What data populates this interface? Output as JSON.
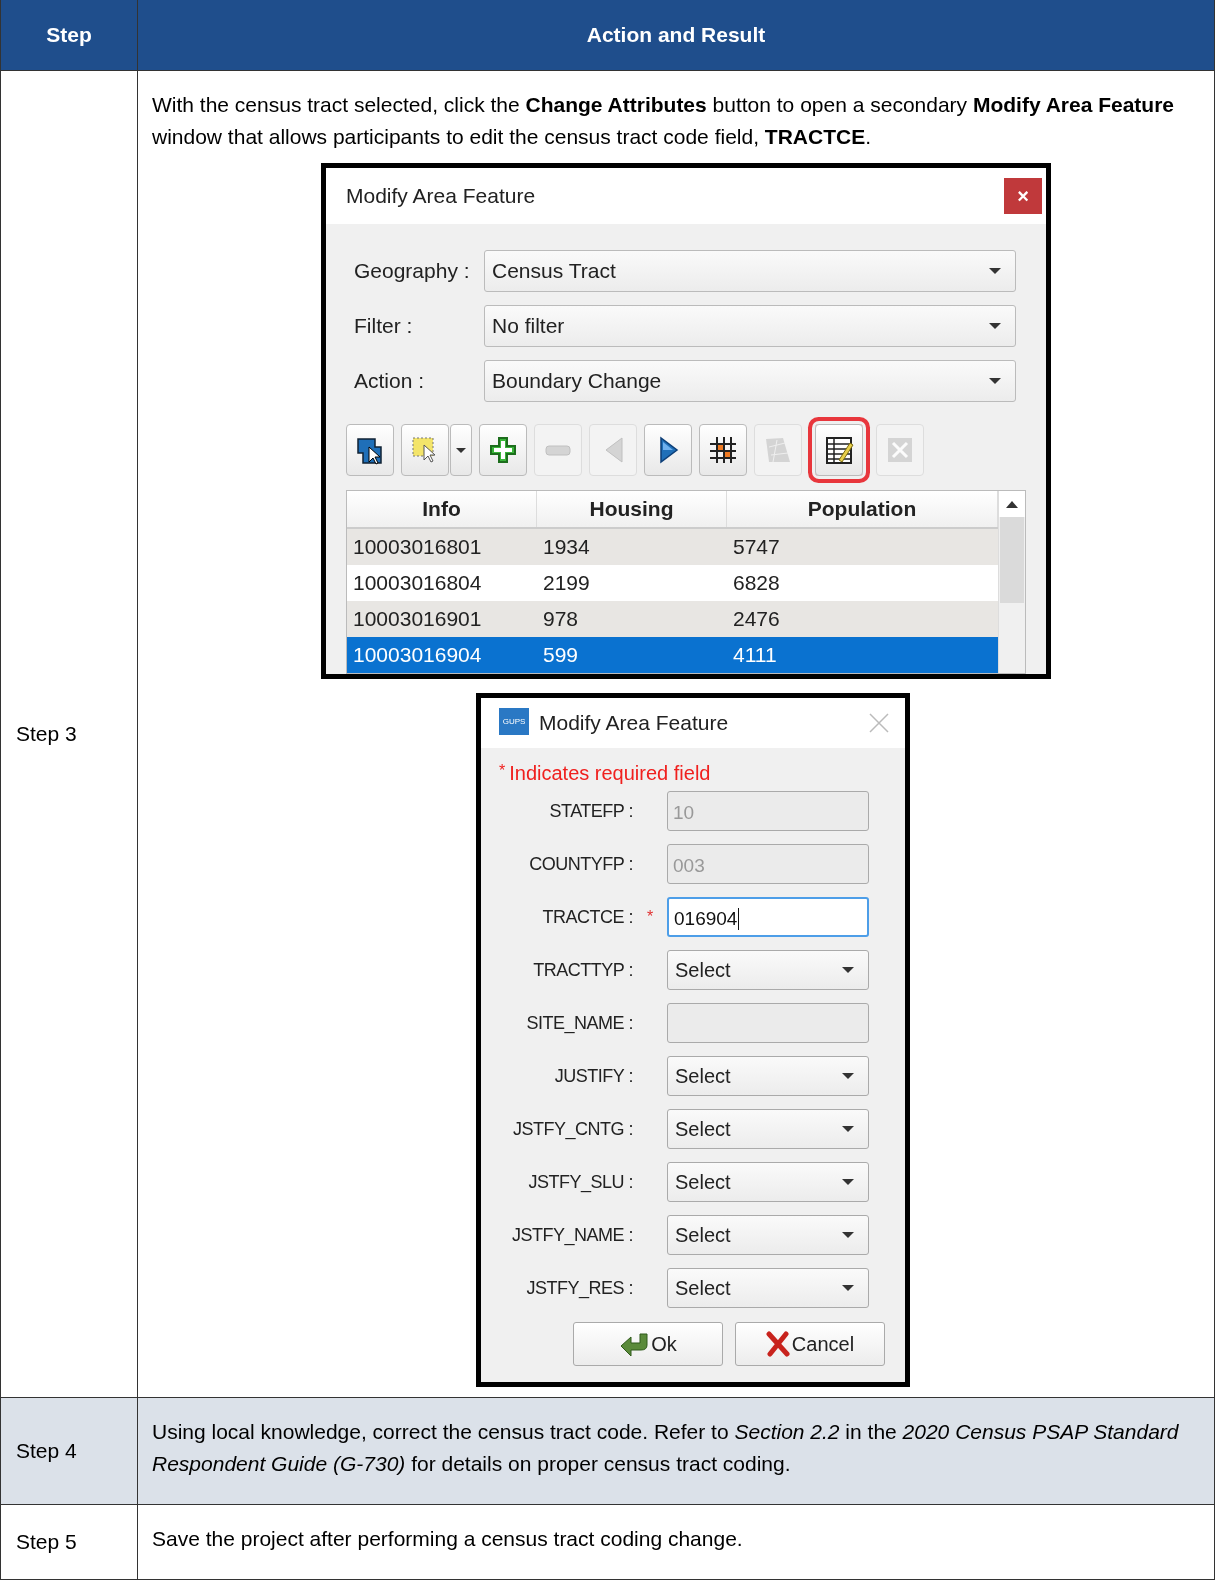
{
  "table": {
    "columns": [
      "Step",
      "Action and Result"
    ],
    "rows": [
      {
        "step": "Step 3",
        "shaded": false,
        "text": "With the census tract selected, click the **Change Attributes** button to open a secondary **Modify Area Feature** window that allows participants to edit the census tract code field, **TRACTCE**.",
        "main_dialog": {
          "title": "Modify Area Feature",
          "close": "×",
          "fields": [
            {
              "label": "Geography :",
              "value": "Census Tract"
            },
            {
              "label": "Filter :",
              "value": "No filter"
            },
            {
              "label": "Action :",
              "value": "Boundary Change"
            }
          ],
          "toolbar": [
            {
              "kind": "select-feature",
              "disabled": false,
              "highlighted": false
            },
            {
              "kind": "select-area",
              "disabled": false,
              "highlighted": false
            },
            {
              "kind": "add",
              "disabled": false,
              "highlighted": false
            },
            {
              "kind": "remove",
              "disabled": true,
              "highlighted": false
            },
            {
              "kind": "previous",
              "disabled": true,
              "highlighted": false
            },
            {
              "kind": "next",
              "disabled": false,
              "highlighted": false
            },
            {
              "kind": "grid",
              "disabled": false,
              "highlighted": false
            },
            {
              "kind": "map",
              "disabled": true,
              "highlighted": false
            },
            {
              "kind": "edit-table",
              "disabled": false,
              "highlighted": true
            },
            {
              "kind": "delete",
              "disabled": true,
              "highlighted": false
            }
          ],
          "grid": {
            "columns": [
              "Info",
              "Housing",
              "Population"
            ],
            "rows": [
              {
                "cells": [
                  "10003016801",
                  "1934",
                  "5747"
                ],
                "selected": false
              },
              {
                "cells": [
                  "10003016804",
                  "2199",
                  "6828"
                ],
                "selected": false
              },
              {
                "cells": [
                  "10003016901",
                  "978",
                  "2476"
                ],
                "selected": false
              },
              {
                "cells": [
                  "10003016904",
                  "599",
                  "4111"
                ],
                "selected": true
              }
            ]
          }
        },
        "attr_dialog": {
          "logo_text": "GUPS",
          "title": "Modify Area Feature",
          "note_mark": "*",
          "note": "Indicates required field",
          "required_mark": "*",
          "fields": [
            {
              "label": "STATEFP :",
              "kind": "text",
              "value": "10",
              "required": false,
              "disabled": true,
              "focused": false
            },
            {
              "label": "COUNTYFP :",
              "kind": "text",
              "value": "003",
              "required": false,
              "disabled": true,
              "focused": false
            },
            {
              "label": "TRACTCE :",
              "kind": "text",
              "value": "016904",
              "required": true,
              "disabled": false,
              "focused": true
            },
            {
              "label": "TRACTTYP :",
              "kind": "select",
              "value": "Select",
              "required": false,
              "disabled": false,
              "focused": false
            },
            {
              "label": "SITE_NAME :",
              "kind": "text",
              "required": false,
              "disabled": true,
              "focused": false
            },
            {
              "label": "JUSTIFY :",
              "kind": "select",
              "value": "Select",
              "required": false,
              "disabled": false,
              "focused": false
            },
            {
              "label": "JSTFY_CNTG :",
              "kind": "select",
              "value": "Select",
              "required": false,
              "disabled": false,
              "focused": false
            },
            {
              "label": "JSTFY_SLU :",
              "kind": "select",
              "value": "Select",
              "required": false,
              "disabled": false,
              "focused": false
            },
            {
              "label": "JSTFY_NAME :",
              "kind": "select",
              "value": "Select",
              "required": false,
              "disabled": false,
              "focused": false
            },
            {
              "label": "JSTFY_RES :",
              "kind": "select",
              "value": "Select",
              "required": false,
              "disabled": false,
              "focused": false
            }
          ],
          "buttons": [
            {
              "kind": "ok",
              "label": "Ok"
            },
            {
              "kind": "cancel",
              "label": "Cancel"
            }
          ]
        }
      },
      {
        "step": "Step 4",
        "shaded": true,
        "text": "Using local knowledge, correct the census tract code. Refer to *Section 2.2* in the *2020 Census PSAP Standard Respondent Guide (G-730)* for details on proper census tract coding."
      },
      {
        "step": "Step 5",
        "shaded": false,
        "text": "Save the project after performing a census tract coding change."
      }
    ]
  }
}
